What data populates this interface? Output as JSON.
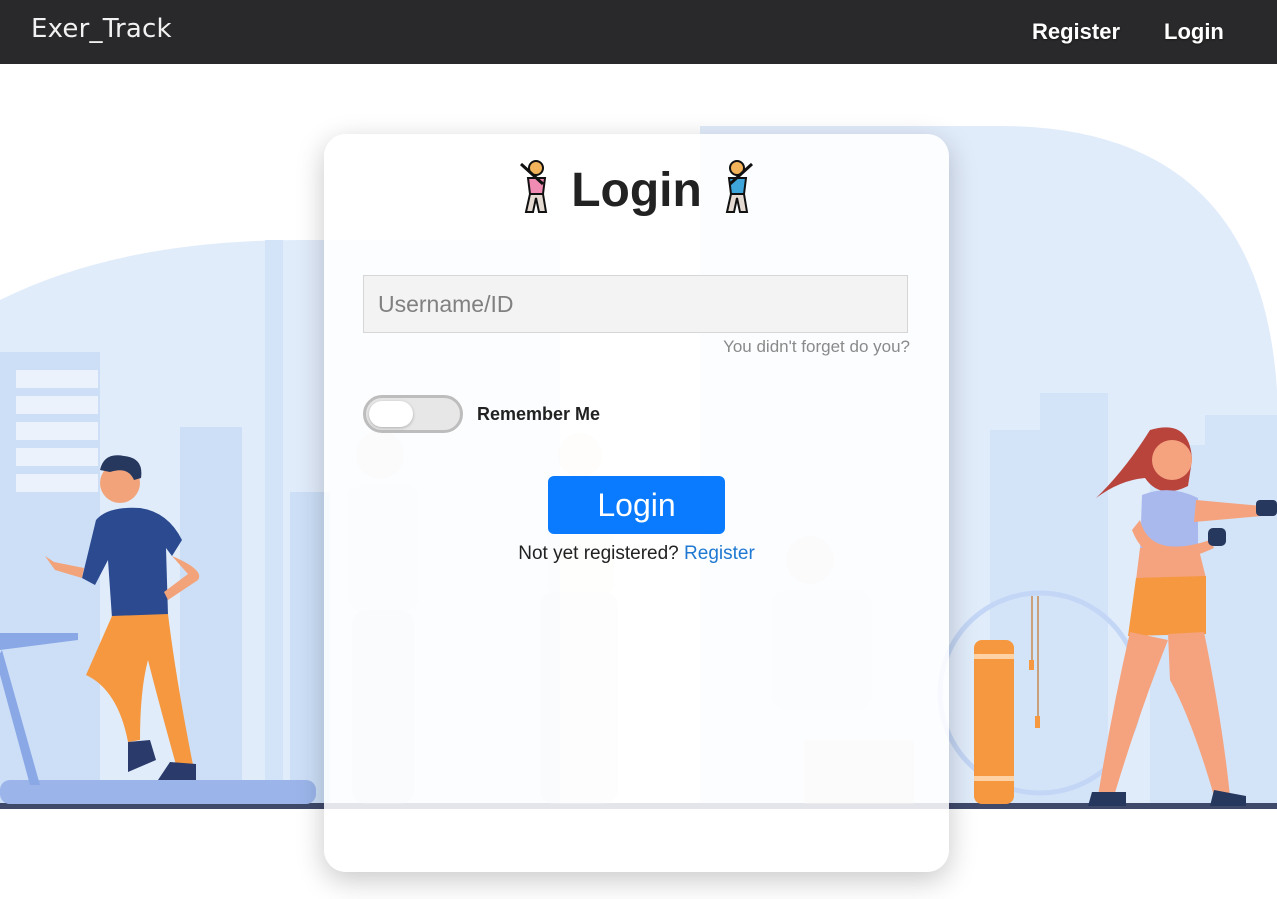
{
  "navbar": {
    "brand": "Exer_Track",
    "links": {
      "register": "Register",
      "login": "Login"
    }
  },
  "login_card": {
    "title": "Login",
    "title_icons": [
      "woman-golfing-icon",
      "man-golfing-icon"
    ],
    "username": {
      "placeholder": "Username/ID",
      "value": ""
    },
    "hint": "You didn't forget do you?",
    "remember_me": {
      "label": "Remember Me",
      "checked": false
    },
    "submit_label": "Login",
    "register_prompt": "Not yet registered?",
    "register_link": "Register"
  },
  "colors": {
    "navbar_bg": "#29292b",
    "primary_button": "#0a7bff",
    "link": "#1f78d1",
    "background_blue": "#dce9fa",
    "accent_orange": "#f59840",
    "shirt_navy": "#2b4a8f"
  }
}
